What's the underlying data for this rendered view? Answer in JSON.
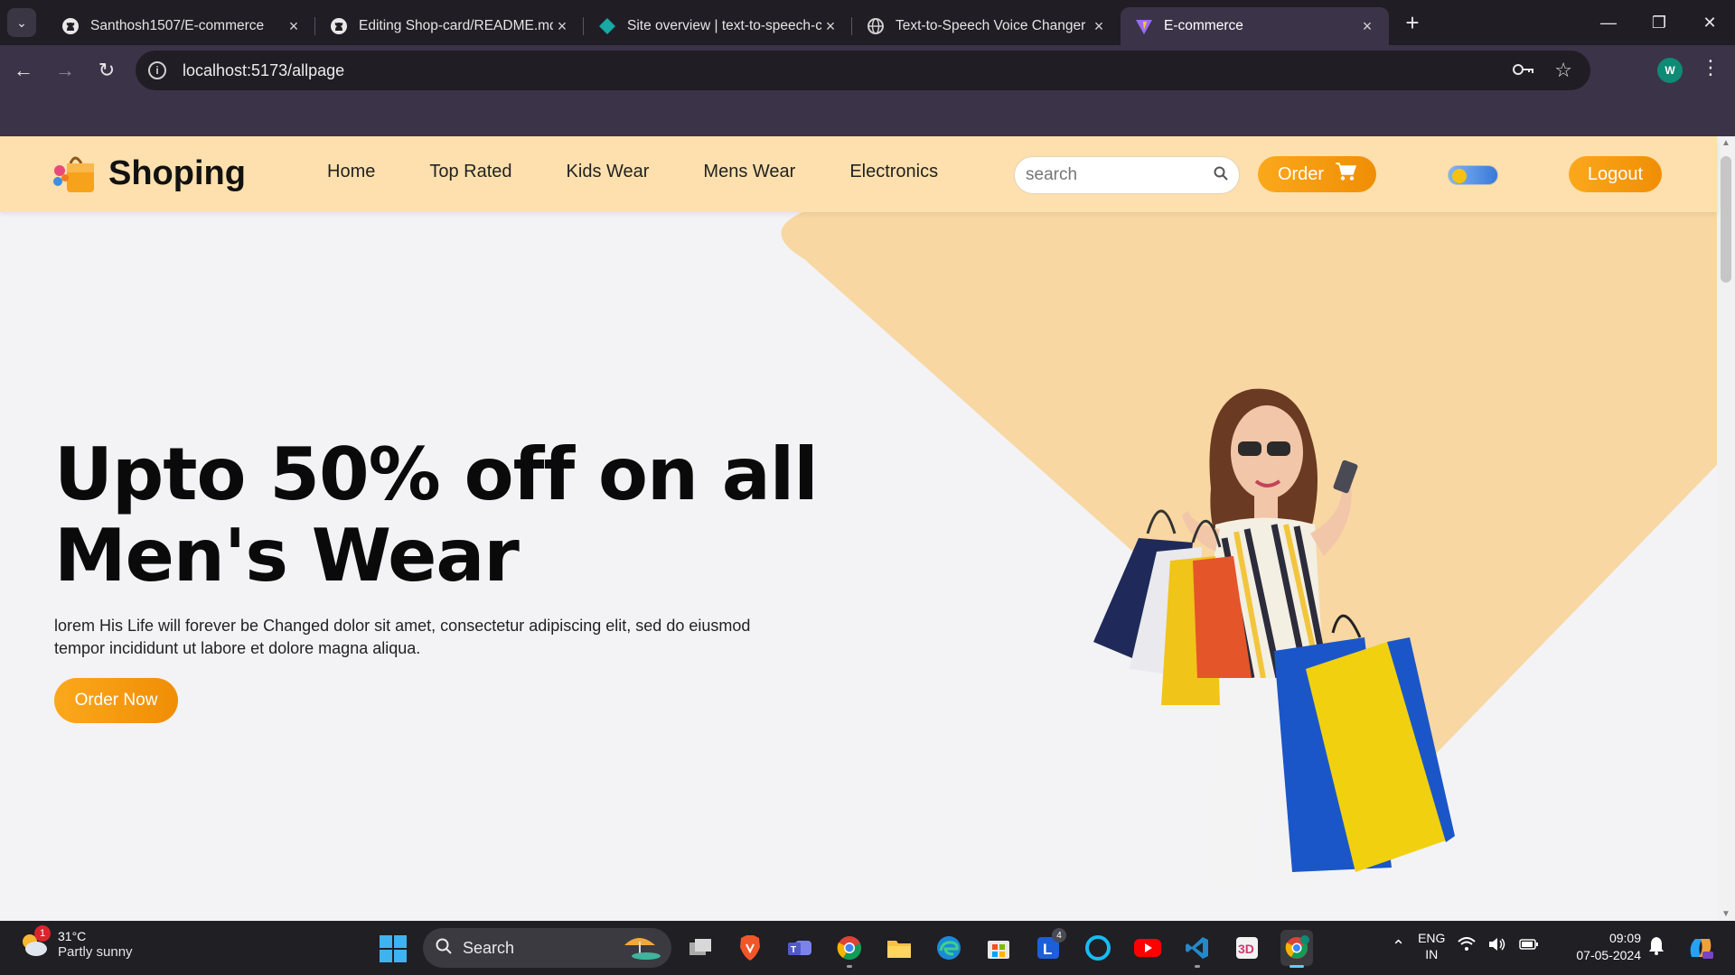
{
  "browser": {
    "tabs": [
      {
        "title": "Santhosh1507/E-commerce",
        "favicon": "github-icon",
        "active": false
      },
      {
        "title": "Editing Shop-card/README.md",
        "favicon": "github-icon",
        "active": false
      },
      {
        "title": "Site overview | text-to-speech-c",
        "favicon": "netlify-icon",
        "active": false
      },
      {
        "title": "Text-to-Speech Voice Changer",
        "favicon": "globe-icon",
        "active": false
      },
      {
        "title": "E-commerce",
        "favicon": "vite-icon",
        "active": true
      }
    ],
    "url": "localhost:5173/allpage",
    "profile_initial": "W"
  },
  "site": {
    "brand": "Shoping",
    "nav": [
      "Home",
      "Top Rated",
      "Kids Wear",
      "Mens Wear",
      "Electronics"
    ],
    "search_placeholder": "search",
    "order_label": "Order",
    "logout_label": "Logout",
    "accent_color": "#f5a623",
    "header_bg": "#fde0ad"
  },
  "hero": {
    "title_line1": "Upto 50% off on all",
    "title_line2": "Men's Wear",
    "description": "lorem His Life will forever be Changed dolor sit amet, consectetur adipiscing elit, sed do eiusmod tempor incididunt ut labore et dolore magna aliqua.",
    "cta_label": "Order Now"
  },
  "taskbar": {
    "weather_temp": "31°C",
    "weather_cond": "Partly sunny",
    "weather_badge": "1",
    "search_label": "Search",
    "apps": [
      {
        "name": "task-view-icon"
      },
      {
        "name": "brave-icon"
      },
      {
        "name": "teams-icon"
      },
      {
        "name": "chrome-icon"
      },
      {
        "name": "file-explorer-icon"
      },
      {
        "name": "edge-icon"
      },
      {
        "name": "store-icon"
      },
      {
        "name": "l-app-icon",
        "badge": "4"
      },
      {
        "name": "alexa-icon"
      },
      {
        "name": "youtube-icon"
      },
      {
        "name": "vscode-icon"
      },
      {
        "name": "3d-app-icon"
      },
      {
        "name": "chrome-profile-icon",
        "active": true
      }
    ],
    "lang_line1": "ENG",
    "lang_line2": "IN",
    "time": "09:09",
    "date": "07-05-2024"
  }
}
